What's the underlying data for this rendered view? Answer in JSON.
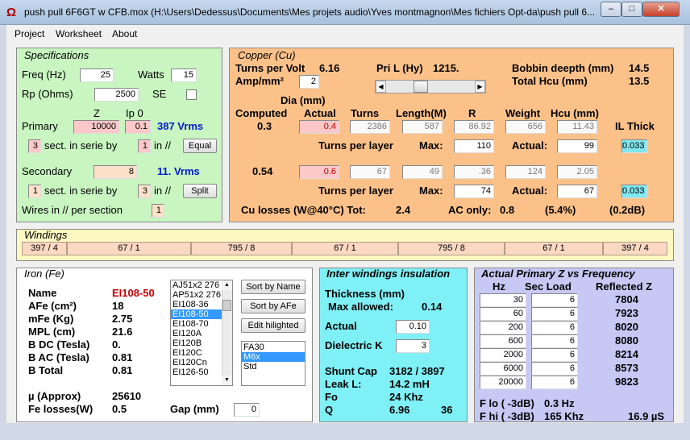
{
  "window": {
    "title": "push pull 6F6GT w CFB.mox  (H:\\Users\\Dedessus\\Documents\\Mes projets audio\\Yves montmagnon\\Mes fichiers Opt-da\\push pull 6...",
    "logo": "Ω",
    "min": "–",
    "max": "□",
    "close": "✕"
  },
  "menu": [
    "Project",
    "Worksheet",
    "About"
  ],
  "spec": {
    "title": "Specifications",
    "freq_label": "Freq (Hz)",
    "freq": "25",
    "watts_label": "Watts",
    "watts": "15",
    "rp_label": "Rp (Ohms)",
    "rp": "2500",
    "se_label": "SE",
    "z_label": "Z",
    "ip0_label": "Ip 0",
    "primary_label": "Primary",
    "primary_z": "10000",
    "primary_ip0": "0.1",
    "primary_vrms": "387 Vrms",
    "p_sect": "3",
    "sect_label": "sect. in serie by",
    "p_par": "1",
    "par_label": "in //",
    "equal": "Equal",
    "secondary_label": "Secondary",
    "secondary_z": "8",
    "secondary_vrms": "11. Vrms",
    "s_sect": "1",
    "s_par": "3",
    "split": "Split",
    "wires_label": "Wires in // per section",
    "wires": "1"
  },
  "copper": {
    "title": "Copper (Cu)",
    "tpv_label": "Turns per Volt",
    "tpv": "6.16",
    "pril_label": "Pri L (Hy)",
    "pril": "1215.",
    "bobbin_label": "Bobbin deepth (mm)",
    "bobbin": "14.5",
    "ampmm_label": "Amp/mm²",
    "ampmm": "2",
    "hcu_total_label": "Total Hcu (mm)",
    "hcu_total": "13.5",
    "dia_label": "Dia (mm)",
    "computed_label": "Computed",
    "actual_label": "Actual",
    "turns_label": "Turns",
    "length_label": "Length(M)",
    "r_label": "R",
    "weight_label": "Weight",
    "hcu_label": "Hcu (mm)",
    "ilthick_label": "IL Thick",
    "row1": {
      "computed": "0.3",
      "actual": "0.4",
      "turns": "2386",
      "length": "587",
      "r": "86.92",
      "weight": "656",
      "hcu": "11.43",
      "il": "0.033",
      "max": "110",
      "act": "99"
    },
    "row2": {
      "computed": "0.54",
      "actual": "0.6",
      "turns": "67",
      "length": "49",
      "r": ".36",
      "weight": "124",
      "hcu": "2.05",
      "il": "0.033",
      "max": "74",
      "act": "67"
    },
    "tpl_label": "Turns per layer",
    "max_label": "Max:",
    "act_label": "Actual:",
    "culoss_label": "Cu losses (W@40°C) Tot:",
    "culoss": "2.4",
    "aconly_label": "AC only:",
    "aconly": "0.8",
    "pct": "(5.4%)",
    "db": "(0.2dB)"
  },
  "windings": {
    "title": "Windings",
    "cells": [
      "397 / 4",
      "67 / 1",
      "795 / 8",
      "67 / 1",
      "795 / 8",
      "67 / 1",
      "397 / 4"
    ]
  },
  "iron": {
    "title": "Iron (Fe)",
    "name_label": "Name",
    "name": "EI108-50",
    "afe_label": "AFe (cm²)",
    "afe": "18",
    "mfe_label": "mFe (Kg)",
    "mfe": "2.75",
    "mpl_label": "MPL (cm)",
    "mpl": "21.6",
    "bdc_label": "B DC (Tesla)",
    "bdc": "0.",
    "bac_label": "B AC (Tesla)",
    "bac": "0.81",
    "btot_label": "B Total",
    "btot": "0.81",
    "mu_label": "µ (Approx)",
    "mu": "25610",
    "felosses_label": "Fe losses(W)",
    "felosses": "0.5",
    "gap_label": "Gap (mm)",
    "gap": "0",
    "cores": [
      "AJ51x2  276",
      "AP51x2  276",
      "EI108-36",
      "EI108-50",
      "EI108-70",
      "EI120A",
      "EI120B",
      "EI120C",
      "EI120Cn",
      "EI126-50"
    ],
    "selected_core": "EI108-50",
    "sort_name": "Sort by Name",
    "sort_afe": "Sort by AFe",
    "edit": "Edit hilighted",
    "materials": [
      "FA30",
      "M6x",
      "Std"
    ],
    "selected_material": "M6x"
  },
  "inter": {
    "title": "Inter windings insulation",
    "thick_label": "Thickness (mm)",
    "maxallowed_label": "Max allowed:",
    "maxallowed": "0.14",
    "actual_label": "Actual",
    "actual": "0.10",
    "dk_label": "Dielectric K",
    "dk": "3",
    "shunt_label": "Shunt Cap",
    "shunt": "3182 / 3897",
    "leak_label": "Leak L:",
    "leak": "14.2 mH",
    "fo_label": "Fo",
    "fo": "24 Khz",
    "q_label": "Q",
    "q": "6.96",
    "q2": "36"
  },
  "zfreq": {
    "title": "Actual Primary Z vs Frequency",
    "hz_label": "Hz",
    "sec_label": "Sec Load",
    "refl_label": "Reflected Z",
    "rows": [
      {
        "hz": "30",
        "load": "6",
        "z": "7804"
      },
      {
        "hz": "60",
        "load": "6",
        "z": "7923"
      },
      {
        "hz": "200",
        "load": "6",
        "z": "8020"
      },
      {
        "hz": "600",
        "load": "6",
        "z": "8080"
      },
      {
        "hz": "2000",
        "load": "6",
        "z": "8214"
      },
      {
        "hz": "6000",
        "load": "6",
        "z": "8573"
      },
      {
        "hz": "20000",
        "load": "6",
        "z": "9823"
      }
    ],
    "flo_label": "F lo ( -3dB)",
    "flo": "0.3 Hz",
    "fhi_label": "F hi ( -3dB)",
    "fhi": "165 Khz",
    "us": "16.9 µS"
  },
  "colors": {
    "spec": "#c8f5c0",
    "copper": "#fcc189",
    "windings": "#fdf8c2",
    "iron": "#ffffff",
    "inter": "#7ff0f5",
    "zfreq": "#c8c8f5"
  }
}
